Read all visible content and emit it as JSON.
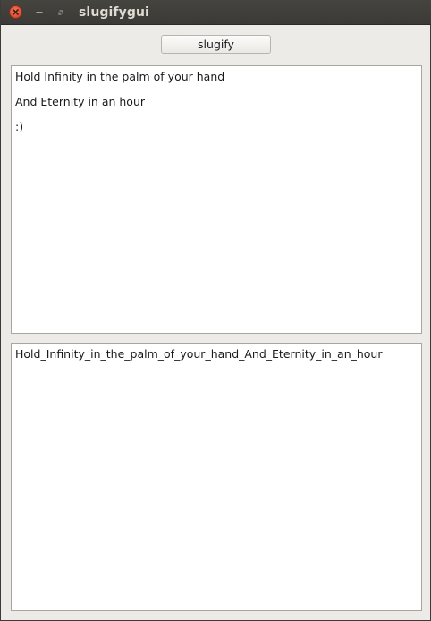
{
  "window": {
    "title": "slugifygui"
  },
  "toolbar": {
    "slugify_label": "slugify"
  },
  "input": {
    "lines": [
      "Hold Infinity in the palm of your hand",
      "And Eternity in an hour",
      ":)"
    ]
  },
  "output": {
    "text": "Hold_Infinity_in_the_palm_of_your_hand_And_Eternity_in_an_hour"
  },
  "colors": {
    "titlebar": "#3c3b37",
    "close_button": "#e0583a",
    "window_bg": "#edebe7"
  },
  "icons": {
    "close": "close-icon",
    "minimize": "minimize-icon",
    "maximize": "maximize-icon"
  }
}
